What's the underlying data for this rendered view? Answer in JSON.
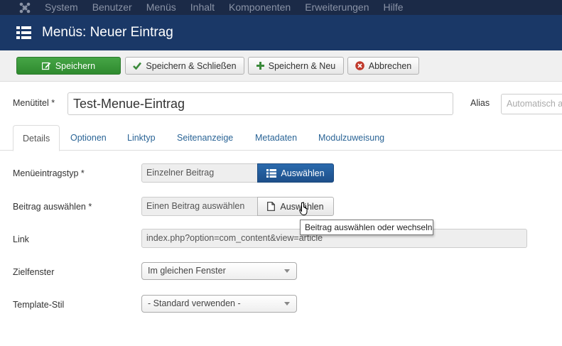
{
  "topnav": {
    "items": [
      "System",
      "Benutzer",
      "Menüs",
      "Inhalt",
      "Komponenten",
      "Erweiterungen",
      "Hilfe"
    ]
  },
  "header": {
    "title": "Menüs: Neuer Eintrag"
  },
  "toolbar": {
    "save_label": "Speichern",
    "save_close_label": "Speichern & Schließen",
    "save_new_label": "Speichern & Neu",
    "cancel_label": "Abbrechen"
  },
  "form": {
    "title_label": "Menütitel *",
    "title_value": "Test-Menue-Eintrag",
    "alias_label": "Alias",
    "alias_placeholder": "Automatisch a"
  },
  "tabs": [
    "Details",
    "Optionen",
    "Linktyp",
    "Seitenanzeige",
    "Metadaten",
    "Modulzuweisung"
  ],
  "fields": {
    "type_label": "Menüeintragstyp *",
    "type_value": "Einzelner Beitrag",
    "type_button": "Auswählen",
    "article_label": "Beitrag auswählen *",
    "article_value": "Einen Beitrag auswählen",
    "article_button": "Auswählen",
    "link_label": "Link",
    "link_value": "index.php?option=com_content&view=article",
    "target_label": "Zielfenster",
    "target_value": "Im gleichen Fenster",
    "template_label": "Template-Stil",
    "template_value": "- Standard verwenden -"
  },
  "tooltip": {
    "text": "Beitrag auswählen oder wechseln"
  },
  "colors": {
    "topnav_bg": "#1b2a47",
    "titlebar_bg": "#1a3867",
    "save_green": "#3c9a3c",
    "primary_blue": "#205a9c",
    "link_blue": "#2a6496"
  }
}
